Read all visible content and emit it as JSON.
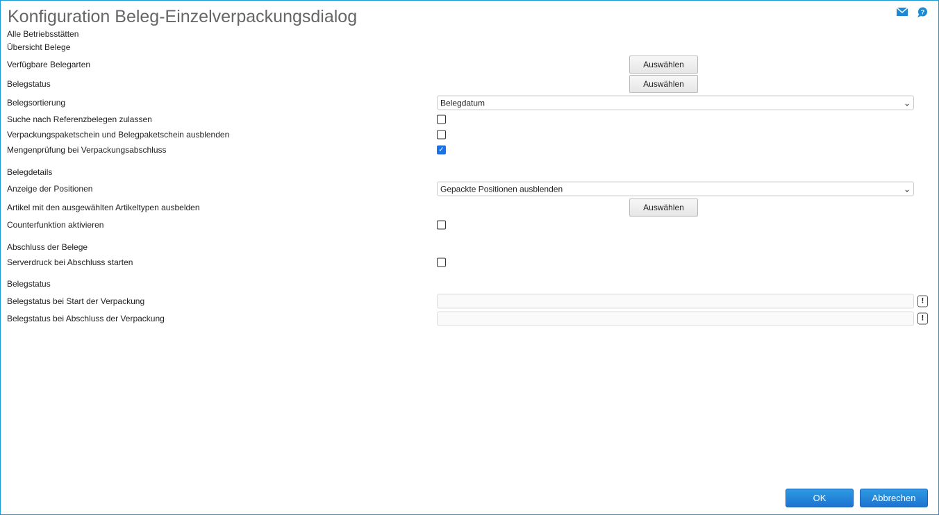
{
  "title": "Konfiguration Beleg-Einzelverpackungsdialog",
  "subtitle1": "Alle Betriebsstätten",
  "subtitle2": "Übersicht Belege",
  "select_label": "Auswählen",
  "rows": {
    "verfuegbare": "Verfügbare Belegarten",
    "belegstatus": "Belegstatus",
    "sortierung": "Belegsortierung",
    "sortierung_value": "Belegdatum",
    "referenz": "Suche nach Referenzbelegen zulassen",
    "paketschein": "Verpackungspaketschein und Belegpaketschein ausblenden",
    "mengen": "Mengenprüfung bei Verpackungsabschluss",
    "belegdetails": "Belegdetails",
    "anzeige": "Anzeige der Positionen",
    "anzeige_value": "Gepackte Positionen ausblenden",
    "artikel": "Artikel mit den ausgewählten Artikeltypen ausbelden",
    "counter": "Counterfunktion aktivieren",
    "abschluss": "Abschluss der Belege",
    "serverdruck": "Serverdruck bei Abschluss starten",
    "belegstatus2": "Belegstatus",
    "start": "Belegstatus bei Start der Verpackung",
    "ende": "Belegstatus bei Abschluss der Verpackung"
  },
  "checks": {
    "referenz": false,
    "paketschein": false,
    "mengen": true,
    "counter": false,
    "serverdruck": false
  },
  "ok": "OK",
  "cancel": "Abbrechen",
  "accent": "#1e73d0"
}
